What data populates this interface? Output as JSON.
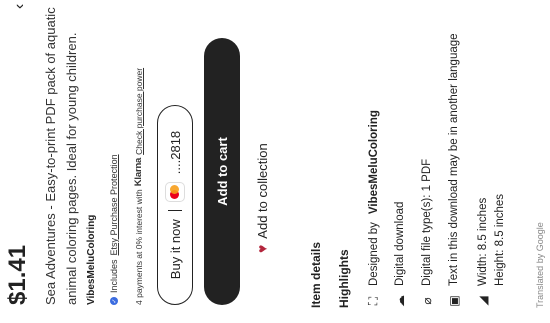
{
  "nav": {
    "chevron": "‹"
  },
  "listing": {
    "price": "$1.41",
    "description": "Sea Adventures - Easy-to-print PDF pack of aquatic animal coloring pages. Ideal for young children.",
    "shop_name": "VibesMeluColoring"
  },
  "protection": {
    "prefix": "Includes",
    "link": "Etsy Purchase Protection"
  },
  "payments": {
    "text": "4 payments at 0% interest with",
    "brand": "Klarna",
    "link": "Check purchase power"
  },
  "buy_now": {
    "label": "Buy it now",
    "card_last4": "....2818"
  },
  "add_to_cart": {
    "label": "Add to cart"
  },
  "collection": {
    "label": "Add to collection"
  },
  "item_details": {
    "heading": "Item details",
    "highlights_heading": "Highlights",
    "designed_prefix": "Designed by",
    "designer": "VibesMeluColoring",
    "digital_download": "Digital download",
    "file_type": "Digital file type(s): 1 PDF",
    "language_note": "Text in this download may be in another language",
    "width": "Width: 8.5 inches",
    "height": "Height: 8.5 inches"
  },
  "footer": {
    "translated": "Translated by Google"
  }
}
